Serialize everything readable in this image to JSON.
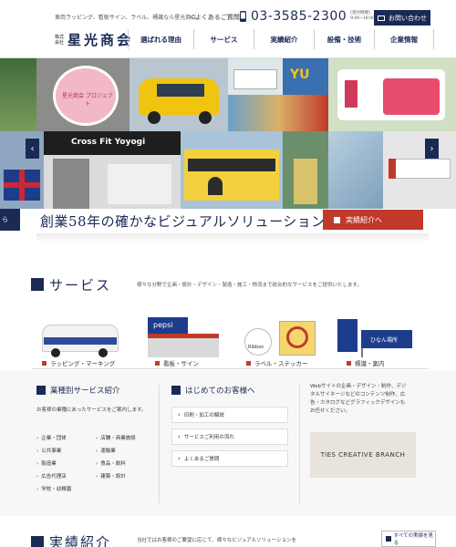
{
  "header": {
    "tagline": "車両ラッピング、看板サイン、ラベル、標識なら星光商会",
    "logo_small": "株式会社",
    "logo_main": "星光商会",
    "faq_link": "よくあるご質問",
    "phone": "03-3585-2300",
    "hours_label": "[受付時間]",
    "hours_value": "9:00~18:00",
    "contact_button": "お問い合わせ",
    "nav": [
      "選ばれる理由",
      "サービス",
      "実績紹介",
      "設備・技術",
      "企業情報"
    ]
  },
  "hero": {
    "prev": "‹",
    "next": "›",
    "tile_texts": {
      "tile_a": "星光商会 プロジェクト",
      "tile_b": "Cross Fit Yoyogi",
      "tile_c": "YU"
    }
  },
  "banner": {
    "left_label": "ら",
    "headline": "創業58年の確かなビジュアルソリューション。",
    "button": "実績紹介へ"
  },
  "service": {
    "title": "サービス",
    "description": "様々な分野で企画・設計・デザイン・製造・施工・物流まで総合的なサービスをご提供いたします。",
    "items": [
      {
        "label": "ラッピング・マーキング",
        "image_text": ""
      },
      {
        "label": "看板・サイン",
        "image_text": "pepsi"
      },
      {
        "label": "ラベル・ステッカー",
        "image_text": "Ribbon"
      },
      {
        "label": "標識・案内",
        "image_text": "ひなん場所"
      }
    ]
  },
  "columns": {
    "industry": {
      "title": "業種別サービス紹介",
      "text": "お客様の業種にあったサービスをご案内します。",
      "items_left": [
        "企業・団体",
        "公共事業",
        "製造業",
        "広告代理店",
        "学校・幼稚園"
      ],
      "items_right": [
        "店舗・商業施設",
        "運輸業",
        "食品・飲料",
        "建築・設計"
      ]
    },
    "first_time": {
      "title": "はじめてのお客様へ",
      "links": [
        "印刷・加工の解説",
        "サービスご利用の流れ",
        "よくあるご質問"
      ]
    },
    "ties": {
      "text_lines": [
        "Webサイトの企画・デザイン・制作、デジ",
        "タルサイネージなどのコンテンツ制作、広",
        "告・カタログなどグラフィックデザインも",
        "お任せください。"
      ],
      "logo_text": "TiES CREATIVE BRANCH"
    }
  },
  "works": {
    "title": "実績紹介",
    "description": "当社ではお客様のご要望に応じて、様々なビジュアルソリューションを",
    "button": "すべての実績を見る"
  },
  "colors": {
    "navy": "#1a2a55",
    "red": "#c0392b"
  }
}
